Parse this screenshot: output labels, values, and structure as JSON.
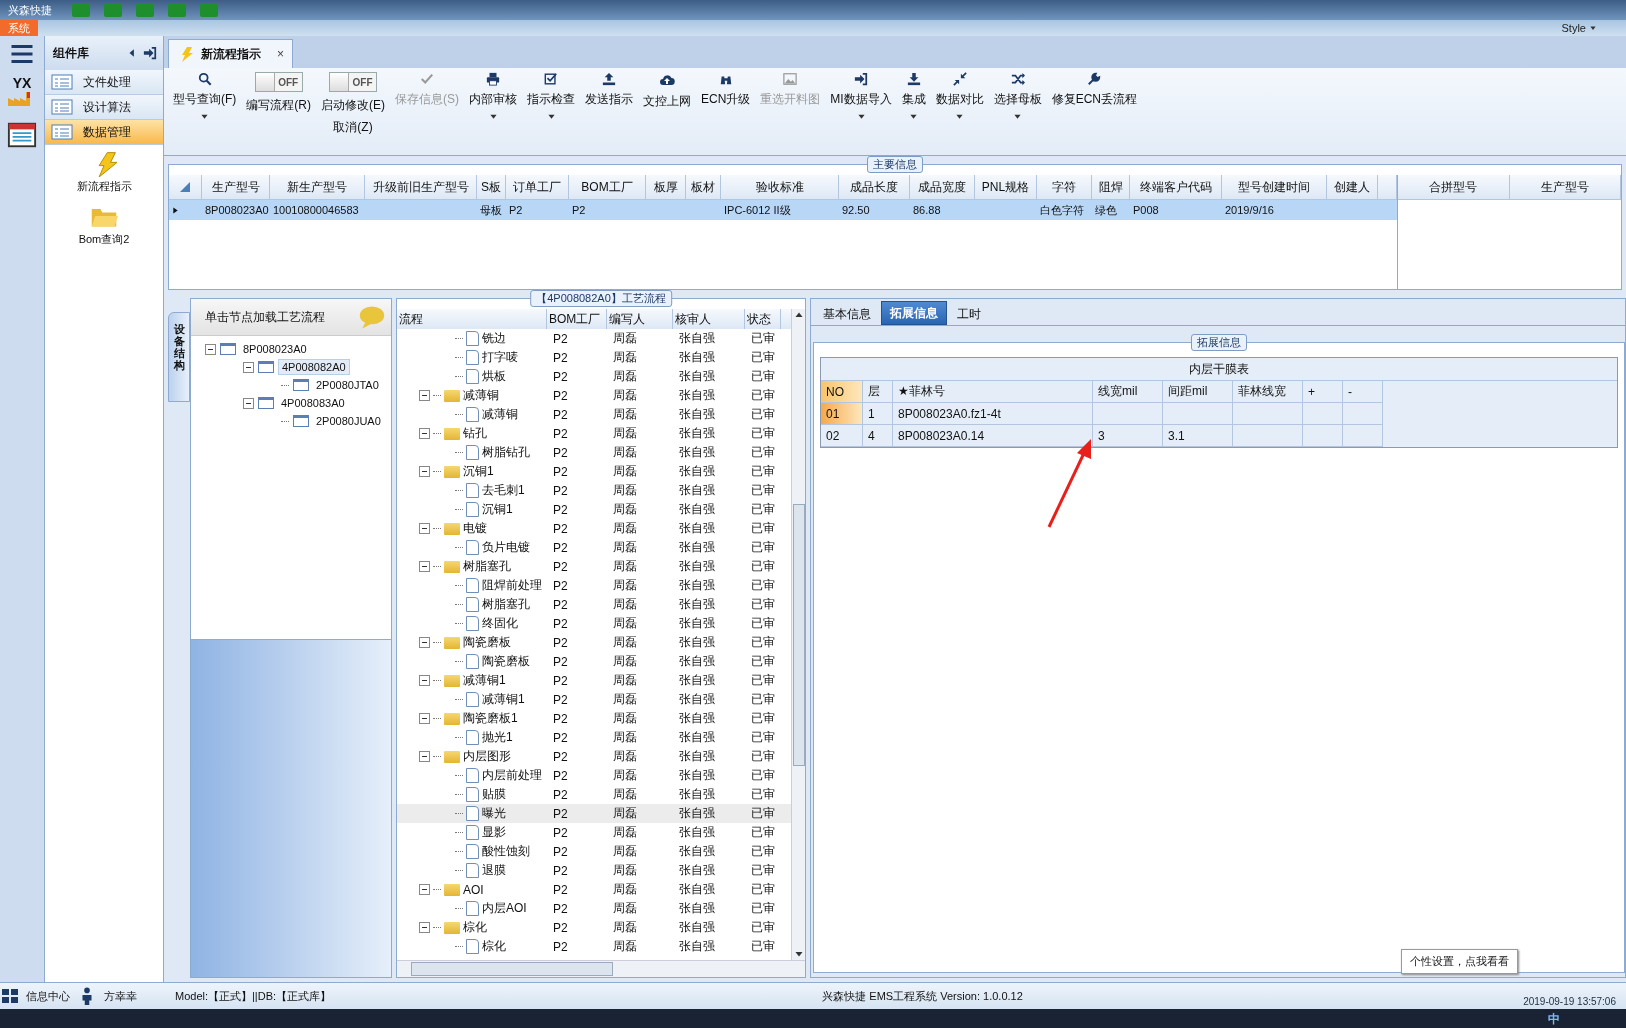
{
  "app": {
    "title": "兴森快捷",
    "menu_tab": "系统",
    "style_label": "Style",
    "logo_text": "YX"
  },
  "sidebar": {
    "title": "组件库",
    "items": [
      {
        "label": "文件处理",
        "selected": false
      },
      {
        "label": "设计算法",
        "selected": false
      },
      {
        "label": "数据管理",
        "selected": true
      }
    ],
    "tiles": [
      {
        "label": "新流程指示",
        "kind": "bolt"
      },
      {
        "label": "Bom查询2",
        "kind": "folder"
      }
    ]
  },
  "doc_tab": {
    "label": "新流程指示",
    "close": "×"
  },
  "toolbar": [
    {
      "kind": "search",
      "label": "型号查询(F)",
      "disabled": false,
      "dropdown": true
    },
    {
      "kind": "toggle",
      "label": "编写流程(R)",
      "state": "OFF",
      "on": false
    },
    {
      "kind": "toggle",
      "label": "启动修改(E)",
      "state": "OFF",
      "on": false,
      "sub_label": "取消(Z)"
    },
    {
      "kind": "check",
      "label": "保存信息(S)",
      "disabled": true,
      "dropdown": false
    },
    {
      "kind": "print",
      "label": "内部审核",
      "disabled": false,
      "dropdown": true
    },
    {
      "kind": "checkbox",
      "label": "指示检查",
      "disabled": false,
      "dropdown": true
    },
    {
      "kind": "upload",
      "label": "发送指示",
      "disabled": false,
      "dropdown": false
    },
    {
      "kind": "cloud",
      "label": "文控上网",
      "disabled": false,
      "dropdown": false
    },
    {
      "kind": "binoculars",
      "label": "ECN升级",
      "disabled": false,
      "dropdown": false
    },
    {
      "kind": "image",
      "label": "重选开料图",
      "disabled": true,
      "dropdown": false
    },
    {
      "kind": "signin",
      "label": "MI数据导入",
      "disabled": false,
      "dropdown": true
    },
    {
      "kind": "download",
      "label": "集成",
      "disabled": false,
      "dropdown": true
    },
    {
      "kind": "compress",
      "label": "数据对比",
      "disabled": false,
      "dropdown": true
    },
    {
      "kind": "shuffle",
      "label": "选择母板",
      "disabled": false,
      "dropdown": true
    },
    {
      "kind": "wrench",
      "label": "修复ECN丢流程",
      "disabled": false,
      "dropdown": false
    }
  ],
  "main_info": {
    "title": "主要信息",
    "columns": [
      "生产型号",
      "新生产型号",
      "升级前旧生产型号",
      "S板",
      "订单工厂",
      "BOM工厂",
      "板厚",
      "板材",
      "验收标准",
      "成品长度",
      "成品宽度",
      "PNL规格",
      "字符",
      "阻焊",
      "终端客户代码",
      "型号创建时间",
      "创建人"
    ],
    "rows": [
      {
        "selected": true,
        "cells": [
          "8P008023A0",
          "10010800046583",
          null,
          "母板",
          "P2",
          "P2",
          null,
          null,
          "IPC-6012 II级",
          "92.50",
          "86.88",
          null,
          "白色字符",
          "绿色",
          "P008",
          "2019/9/16",
          null
        ]
      }
    ],
    "side_columns": [
      "合拼型号",
      "生产型号"
    ]
  },
  "structure": {
    "side_tab": "设备结构",
    "hint": "单击节点加载工艺流程",
    "tree": [
      {
        "label": "8P008023A0",
        "selected": false,
        "expanded": true,
        "children": [
          {
            "label": "4P008082A0",
            "selected": true,
            "expanded": true,
            "children": [
              {
                "label": "2P0080JTA0",
                "selected": false
              }
            ]
          },
          {
            "label": "4P008083A0",
            "selected": false,
            "expanded": true,
            "children": [
              {
                "label": "2P0080JUA0",
                "selected": false
              }
            ]
          }
        ]
      }
    ]
  },
  "process": {
    "title": "【4P008082A0】工艺流程",
    "columns": [
      "流程",
      "BOM工厂",
      "编写人",
      "核审人",
      "状态"
    ],
    "rows": [
      {
        "children": [
          {
            "name": "铣边",
            "bom": "P2",
            "writer": "周磊",
            "reviewer": "张自强",
            "status": "已审",
            "selected": false
          },
          {
            "name": "打字唛",
            "bom": "P2",
            "writer": "周磊",
            "reviewer": "张自强",
            "status": "已审",
            "selected": false
          },
          {
            "name": "烘板",
            "bom": "P2",
            "writer": "周磊",
            "reviewer": "张自强",
            "status": "已审",
            "selected": false
          }
        ]
      },
      {
        "name": "减薄铜",
        "bom": "P2",
        "writer": "周磊",
        "reviewer": "张自强",
        "status": "已审",
        "selected": false,
        "expanded": true,
        "children": [
          {
            "name": "减薄铜",
            "bom": "P2",
            "writer": "周磊",
            "reviewer": "张自强",
            "status": "已审",
            "selected": false
          }
        ]
      },
      {
        "name": "钻孔",
        "bom": "P2",
        "writer": "周磊",
        "reviewer": "张自强",
        "status": "已审",
        "selected": false,
        "expanded": true,
        "children": [
          {
            "name": "树脂钻孔",
            "bom": "P2",
            "writer": "周磊",
            "reviewer": "张自强",
            "status": "已审",
            "selected": false
          }
        ]
      },
      {
        "name": "沉铜1",
        "bom": "P2",
        "writer": "周磊",
        "reviewer": "张自强",
        "status": "已审",
        "selected": false,
        "expanded": true,
        "children": [
          {
            "name": "去毛刺1",
            "bom": "P2",
            "writer": "周磊",
            "reviewer": "张自强",
            "status": "已审",
            "selected": false
          },
          {
            "name": "沉铜1",
            "bom": "P2",
            "writer": "周磊",
            "reviewer": "张自强",
            "status": "已审",
            "selected": false
          }
        ]
      },
      {
        "name": "电镀",
        "bom": "P2",
        "writer": "周磊",
        "reviewer": "张自强",
        "status": "已审",
        "selected": false,
        "expanded": true,
        "children": [
          {
            "name": "负片电镀",
            "bom": "P2",
            "writer": "周磊",
            "reviewer": "张自强",
            "status": "已审",
            "selected": false
          }
        ]
      },
      {
        "name": "树脂塞孔",
        "bom": "P2",
        "writer": "周磊",
        "reviewer": "张自强",
        "status": "已审",
        "selected": false,
        "expanded": true,
        "children": [
          {
            "name": "阻焊前处理",
            "bom": "P2",
            "writer": "周磊",
            "reviewer": "张自强",
            "status": "已审",
            "selected": false
          },
          {
            "name": "树脂塞孔",
            "bom": "P2",
            "writer": "周磊",
            "reviewer": "张自强",
            "status": "已审",
            "selected": false
          },
          {
            "name": "终固化",
            "bom": "P2",
            "writer": "周磊",
            "reviewer": "张自强",
            "status": "已审",
            "selected": false
          }
        ]
      },
      {
        "name": "陶瓷磨板",
        "bom": "P2",
        "writer": "周磊",
        "reviewer": "张自强",
        "status": "已审",
        "selected": false,
        "expanded": true,
        "children": [
          {
            "name": "陶瓷磨板",
            "bom": "P2",
            "writer": "周磊",
            "reviewer": "张自强",
            "status": "已审",
            "selected": false
          }
        ]
      },
      {
        "name": "减薄铜1",
        "bom": "P2",
        "writer": "周磊",
        "reviewer": "张自强",
        "status": "已审",
        "selected": false,
        "expanded": true,
        "children": [
          {
            "name": "减薄铜1",
            "bom": "P2",
            "writer": "周磊",
            "reviewer": "张自强",
            "status": "已审",
            "selected": false
          }
        ]
      },
      {
        "name": "陶瓷磨板1",
        "bom": "P2",
        "writer": "周磊",
        "reviewer": "张自强",
        "status": "已审",
        "selected": false,
        "expanded": true,
        "children": [
          {
            "name": "抛光1",
            "bom": "P2",
            "writer": "周磊",
            "reviewer": "张自强",
            "status": "已审",
            "selected": false
          }
        ]
      },
      {
        "name": "内层图形",
        "bom": "P2",
        "writer": "周磊",
        "reviewer": "张自强",
        "status": "已审",
        "selected": false,
        "expanded": true,
        "children": [
          {
            "name": "内层前处理",
            "bom": "P2",
            "writer": "周磊",
            "reviewer": "张自强",
            "status": "已审",
            "selected": false
          },
          {
            "name": "贴膜",
            "bom": "P2",
            "writer": "周磊",
            "reviewer": "张自强",
            "status": "已审",
            "selected": false
          },
          {
            "name": "曝光",
            "bom": "P2",
            "writer": "周磊",
            "reviewer": "张自强",
            "status": "已审",
            "selected": true
          },
          {
            "name": "显影",
            "bom": "P2",
            "writer": "周磊",
            "reviewer": "张自强",
            "status": "已审",
            "selected": false
          },
          {
            "name": "酸性蚀刻",
            "bom": "P2",
            "writer": "周磊",
            "reviewer": "张自强",
            "status": "已审",
            "selected": false
          },
          {
            "name": "退膜",
            "bom": "P2",
            "writer": "周磊",
            "reviewer": "张自强",
            "status": "已审",
            "selected": false
          }
        ]
      },
      {
        "name": "AOI",
        "bom": "P2",
        "writer": "周磊",
        "reviewer": "张自强",
        "status": "已审",
        "selected": false,
        "expanded": true,
        "children": [
          {
            "name": "内层AOI",
            "bom": "P2",
            "writer": "周磊",
            "reviewer": "张自强",
            "status": "已审",
            "selected": false
          }
        ]
      },
      {
        "name": "棕化",
        "bom": "P2",
        "writer": "周磊",
        "reviewer": "张自强",
        "status": "已审",
        "selected": false,
        "expanded": true,
        "children": [
          {
            "name": "棕化",
            "bom": "P2",
            "writer": "周磊",
            "reviewer": "张自强",
            "status": "已审",
            "selected": false
          }
        ]
      }
    ]
  },
  "detail": {
    "tabs": [
      {
        "label": "基本信息",
        "selected": false
      },
      {
        "label": "拓展信息",
        "selected": true
      },
      {
        "label": "工时",
        "selected": false
      }
    ],
    "group_title": "拓展信息",
    "table_title": "内层干膜表",
    "columns": [
      "NO",
      "层",
      "★菲林号",
      "线宽mil",
      "间距mil",
      "菲林线宽",
      "+",
      "-"
    ],
    "rows": [
      {
        "selected": true,
        "cells": [
          "01",
          "1",
          "8P008023A0.fz1-4t",
          null,
          null,
          null,
          null,
          null
        ]
      },
      {
        "selected": false,
        "cells": [
          "02",
          "4",
          "8P008023A0.14",
          "3",
          "3.1",
          null,
          null,
          null
        ]
      }
    ]
  },
  "status_bar": {
    "info_center": "信息中心",
    "user": "方幸幸",
    "env": "Model:【正式】||DB:【正式库】",
    "version": "兴森快捷 EMS工程系统 Version: 1.0.0.12",
    "tooltip": "个性设置，点我看看",
    "clock": "2019-09-19 13:57:06",
    "ime": "中"
  }
}
